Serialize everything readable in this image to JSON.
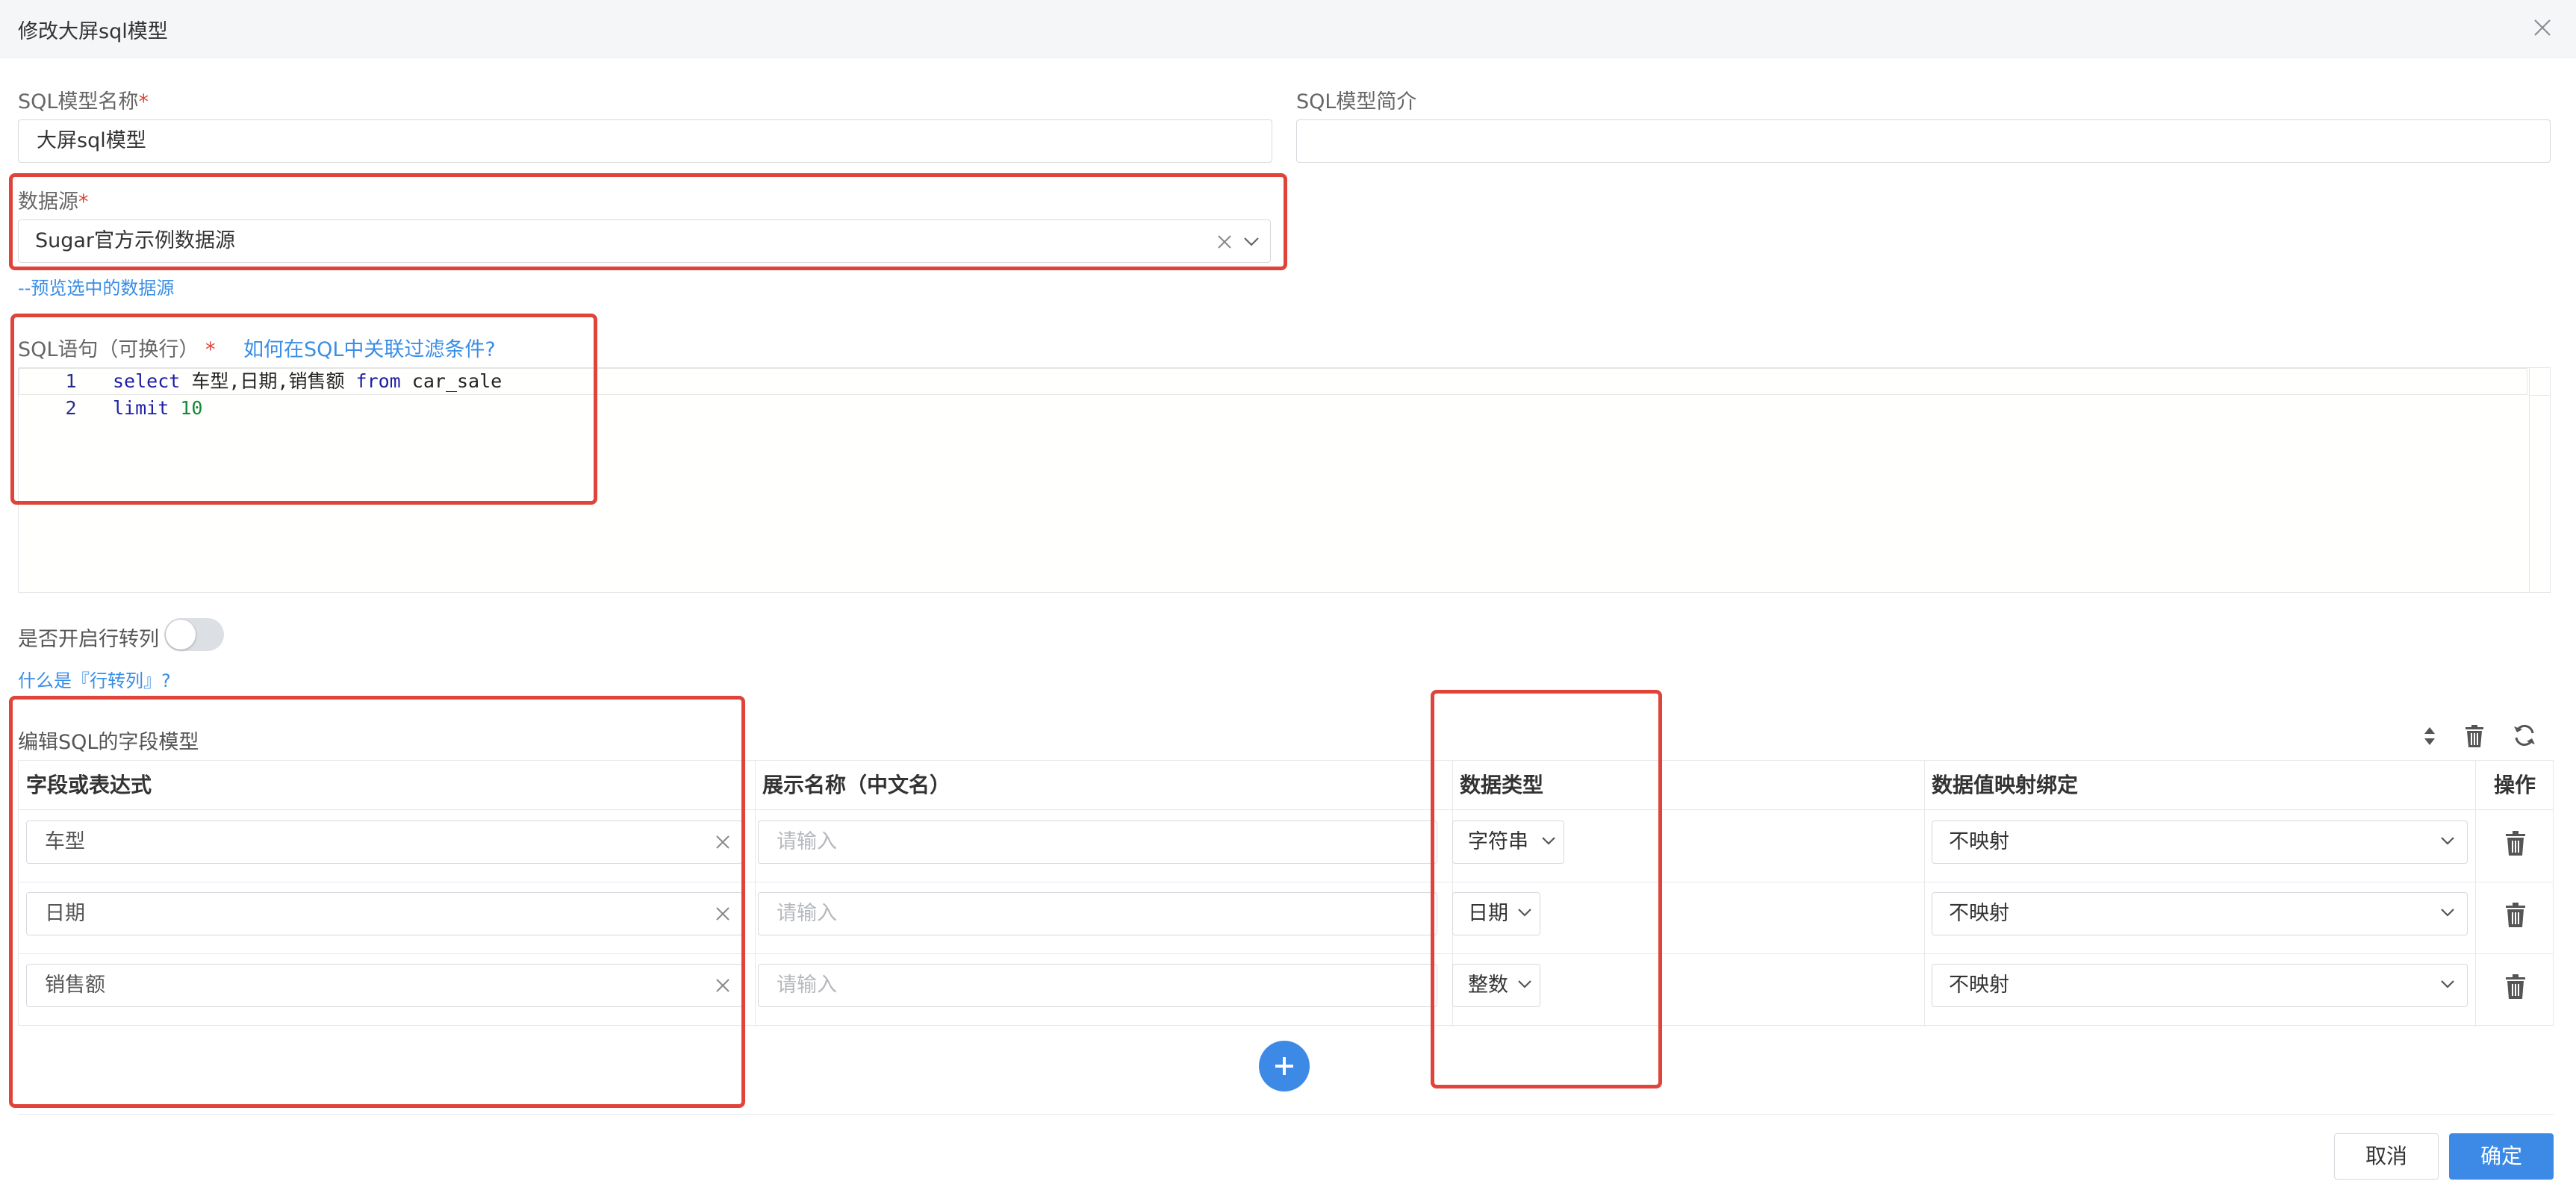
{
  "dialog": {
    "title": "修改大屏sql模型"
  },
  "form": {
    "model_name": {
      "label": "SQL模型名称",
      "required_mark": "*",
      "value": "大屏sql模型"
    },
    "model_desc": {
      "label": "SQL模型简介",
      "value": ""
    },
    "datasource": {
      "label": "数据源",
      "required_mark": "*",
      "value": "Sugar官方示例数据源",
      "preview_link": "--预览选中的数据源"
    },
    "sql": {
      "label": "SQL语句（可换行）",
      "required_mark": "*",
      "help_link": "如何在SQL中关联过滤条件?",
      "lines": [
        {
          "num": "1",
          "text": "select 车型,日期,销售额 from car_sale"
        },
        {
          "num": "2",
          "text": "limit 10"
        }
      ]
    },
    "row_to_col": {
      "label": "是否开启行转列",
      "enabled": false,
      "help_link": "什么是『行转列』?"
    }
  },
  "field_model": {
    "title": "编辑SQL的字段模型",
    "columns": [
      "字段或表达式",
      "展示名称（中文名）",
      "数据类型",
      "数据值映射绑定",
      "操作"
    ],
    "rows": [
      {
        "field": "车型",
        "display_name": "",
        "display_placeholder": "请输入",
        "data_type": "字符串",
        "mapping": "不映射"
      },
      {
        "field": "日期",
        "display_name": "",
        "display_placeholder": "请输入",
        "data_type": "日期",
        "mapping": "不映射"
      },
      {
        "field": "销售额",
        "display_name": "",
        "display_placeholder": "请输入",
        "data_type": "整数",
        "mapping": "不映射"
      }
    ]
  },
  "footer": {
    "cancel_label": "取消",
    "ok_label": "确定"
  },
  "colors": {
    "accent": "#3d8ae6",
    "annotation": "#e0433a",
    "required": "#e0433a"
  }
}
